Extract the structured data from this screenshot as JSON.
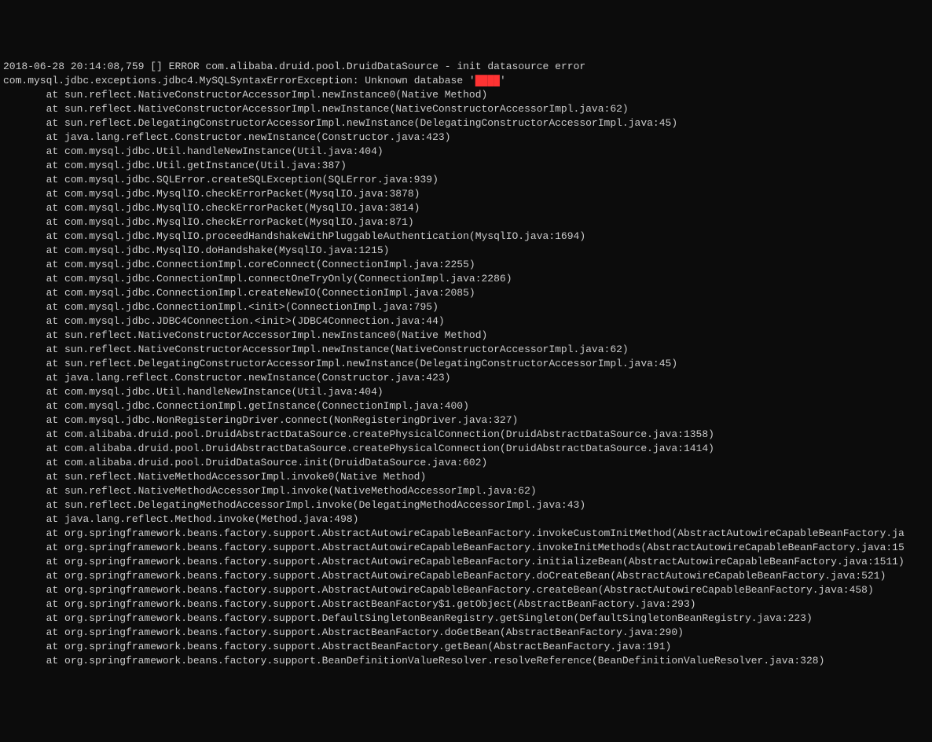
{
  "timestamp": "2018-06-28 20:14:08,759",
  "level": "ERROR",
  "logger": "com.alibaba.druid.pool.DruidDataSource",
  "message": "init datasource error",
  "exception_class": "com.mysql.jdbc.exceptions.jdbc4.MySQLSyntaxErrorException",
  "exception_message_prefix": "Unknown database '",
  "redacted_db_name": "████",
  "exception_message_suffix": "'",
  "stack_trace": [
    "at sun.reflect.NativeConstructorAccessorImpl.newInstance0(Native Method)",
    "at sun.reflect.NativeConstructorAccessorImpl.newInstance(NativeConstructorAccessorImpl.java:62)",
    "at sun.reflect.DelegatingConstructorAccessorImpl.newInstance(DelegatingConstructorAccessorImpl.java:45)",
    "at java.lang.reflect.Constructor.newInstance(Constructor.java:423)",
    "at com.mysql.jdbc.Util.handleNewInstance(Util.java:404)",
    "at com.mysql.jdbc.Util.getInstance(Util.java:387)",
    "at com.mysql.jdbc.SQLError.createSQLException(SQLError.java:939)",
    "at com.mysql.jdbc.MysqlIO.checkErrorPacket(MysqlIO.java:3878)",
    "at com.mysql.jdbc.MysqlIO.checkErrorPacket(MysqlIO.java:3814)",
    "at com.mysql.jdbc.MysqlIO.checkErrorPacket(MysqlIO.java:871)",
    "at com.mysql.jdbc.MysqlIO.proceedHandshakeWithPluggableAuthentication(MysqlIO.java:1694)",
    "at com.mysql.jdbc.MysqlIO.doHandshake(MysqlIO.java:1215)",
    "at com.mysql.jdbc.ConnectionImpl.coreConnect(ConnectionImpl.java:2255)",
    "at com.mysql.jdbc.ConnectionImpl.connectOneTryOnly(ConnectionImpl.java:2286)",
    "at com.mysql.jdbc.ConnectionImpl.createNewIO(ConnectionImpl.java:2085)",
    "at com.mysql.jdbc.ConnectionImpl.<init>(ConnectionImpl.java:795)",
    "at com.mysql.jdbc.JDBC4Connection.<init>(JDBC4Connection.java:44)",
    "at sun.reflect.NativeConstructorAccessorImpl.newInstance0(Native Method)",
    "at sun.reflect.NativeConstructorAccessorImpl.newInstance(NativeConstructorAccessorImpl.java:62)",
    "at sun.reflect.DelegatingConstructorAccessorImpl.newInstance(DelegatingConstructorAccessorImpl.java:45)",
    "at java.lang.reflect.Constructor.newInstance(Constructor.java:423)",
    "at com.mysql.jdbc.Util.handleNewInstance(Util.java:404)",
    "at com.mysql.jdbc.ConnectionImpl.getInstance(ConnectionImpl.java:400)",
    "at com.mysql.jdbc.NonRegisteringDriver.connect(NonRegisteringDriver.java:327)",
    "at com.alibaba.druid.pool.DruidAbstractDataSource.createPhysicalConnection(DruidAbstractDataSource.java:1358)",
    "at com.alibaba.druid.pool.DruidAbstractDataSource.createPhysicalConnection(DruidAbstractDataSource.java:1414)",
    "at com.alibaba.druid.pool.DruidDataSource.init(DruidDataSource.java:602)",
    "at sun.reflect.NativeMethodAccessorImpl.invoke0(Native Method)",
    "at sun.reflect.NativeMethodAccessorImpl.invoke(NativeMethodAccessorImpl.java:62)",
    "at sun.reflect.DelegatingMethodAccessorImpl.invoke(DelegatingMethodAccessorImpl.java:43)",
    "at java.lang.reflect.Method.invoke(Method.java:498)",
    "at org.springframework.beans.factory.support.AbstractAutowireCapableBeanFactory.invokeCustomInitMethod(AbstractAutowireCapableBeanFactory.ja",
    "at org.springframework.beans.factory.support.AbstractAutowireCapableBeanFactory.invokeInitMethods(AbstractAutowireCapableBeanFactory.java:15",
    "at org.springframework.beans.factory.support.AbstractAutowireCapableBeanFactory.initializeBean(AbstractAutowireCapableBeanFactory.java:1511)",
    "at org.springframework.beans.factory.support.AbstractAutowireCapableBeanFactory.doCreateBean(AbstractAutowireCapableBeanFactory.java:521)",
    "at org.springframework.beans.factory.support.AbstractAutowireCapableBeanFactory.createBean(AbstractAutowireCapableBeanFactory.java:458)",
    "at org.springframework.beans.factory.support.AbstractBeanFactory$1.getObject(AbstractBeanFactory.java:293)",
    "at org.springframework.beans.factory.support.DefaultSingletonBeanRegistry.getSingleton(DefaultSingletonBeanRegistry.java:223)",
    "at org.springframework.beans.factory.support.AbstractBeanFactory.doGetBean(AbstractBeanFactory.java:290)",
    "at org.springframework.beans.factory.support.AbstractBeanFactory.getBean(AbstractBeanFactory.java:191)",
    "at org.springframework.beans.factory.support.BeanDefinitionValueResolver.resolveReference(BeanDefinitionValueResolver.java:328)"
  ],
  "stack_indent": "       "
}
